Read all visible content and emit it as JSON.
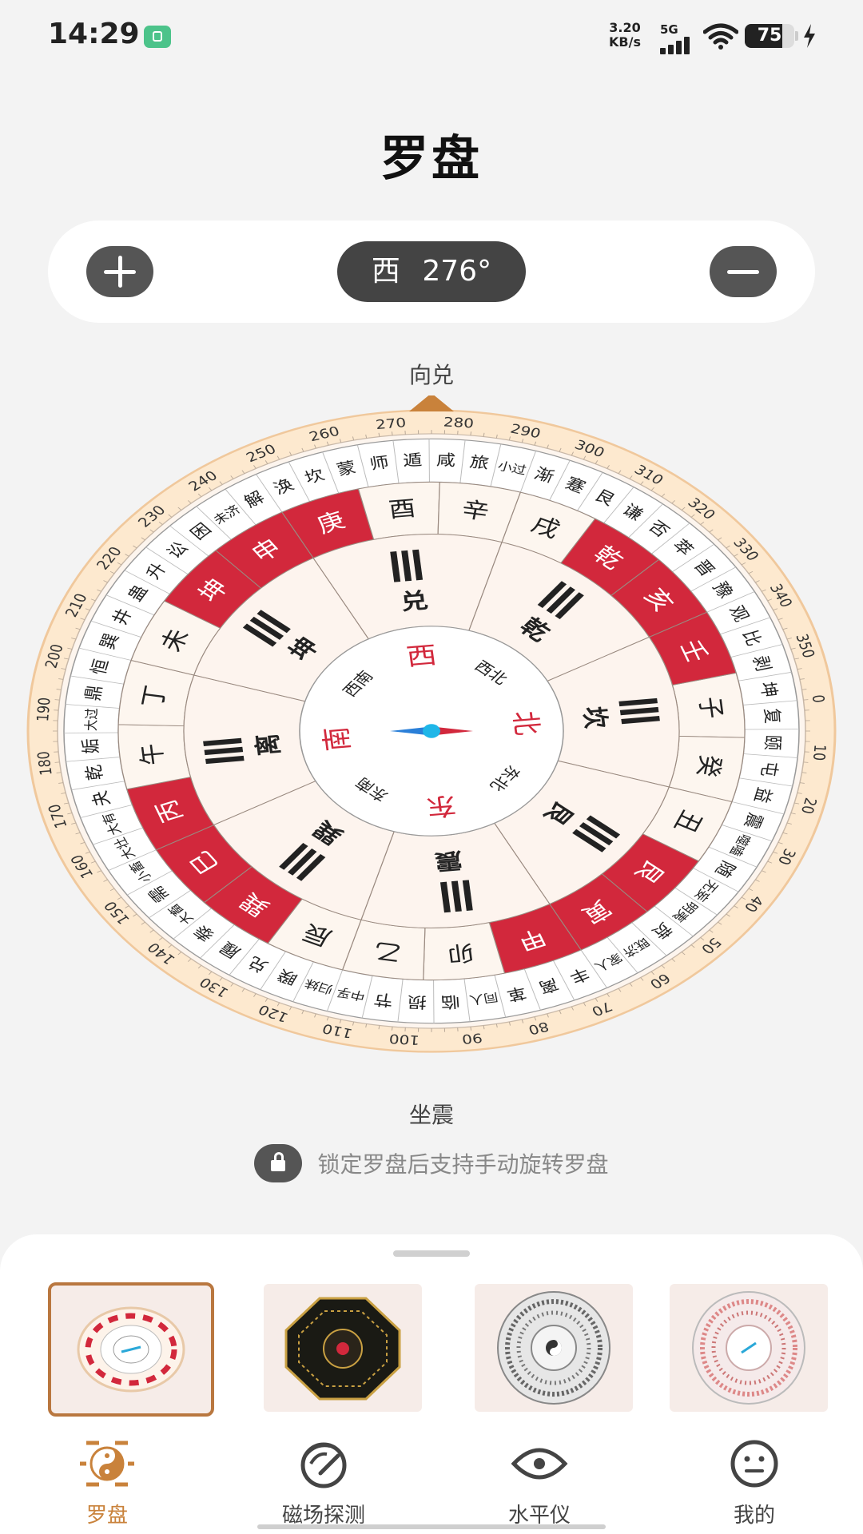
{
  "status_bar": {
    "time": "14:29",
    "net_speed_value": "3.20",
    "net_speed_unit": "KB/s",
    "network_type": "5G",
    "battery_level": "75",
    "icons": [
      "app-notification-icon",
      "signal-bars-icon",
      "wifi-icon",
      "battery-icon",
      "charging-icon"
    ]
  },
  "header": {
    "title": "罗盘"
  },
  "controls": {
    "zoom_in_icon": "plus-icon",
    "zoom_out_icon": "minus-icon",
    "direction": "西",
    "degrees": "276°"
  },
  "compass": {
    "facing": "向兑",
    "sitting": "坐震",
    "rotation_degrees": 276,
    "inner_directions": [
      {
        "label": "南",
        "angle": 180,
        "red": true
      },
      {
        "label": "西南",
        "angle": 225,
        "red": false
      },
      {
        "label": "西",
        "angle": 270,
        "red": true
      },
      {
        "label": "西北",
        "angle": 315,
        "red": false
      },
      {
        "label": "北",
        "angle": 0,
        "red": true
      },
      {
        "label": "东北",
        "angle": 45,
        "red": false
      },
      {
        "label": "东",
        "angle": 90,
        "red": true
      },
      {
        "label": "东南",
        "angle": 135,
        "red": false
      }
    ],
    "trigrams": [
      {
        "name": "离",
        "angle": 180
      },
      {
        "name": "坤",
        "angle": 225
      },
      {
        "name": "兑",
        "angle": 270
      },
      {
        "name": "乾",
        "angle": 315
      },
      {
        "name": "坎",
        "angle": 0
      },
      {
        "name": "艮",
        "angle": 45
      },
      {
        "name": "震",
        "angle": 90
      },
      {
        "name": "巽",
        "angle": 135
      }
    ],
    "mountains": [
      {
        "name": "子",
        "red": false
      },
      {
        "name": "癸",
        "red": false
      },
      {
        "name": "丑",
        "red": false
      },
      {
        "name": "艮",
        "red": true
      },
      {
        "name": "寅",
        "red": true
      },
      {
        "name": "甲",
        "red": true
      },
      {
        "name": "卯",
        "red": false
      },
      {
        "name": "乙",
        "red": false
      },
      {
        "name": "辰",
        "red": false
      },
      {
        "name": "巽",
        "red": true
      },
      {
        "name": "巳",
        "red": true
      },
      {
        "name": "丙",
        "red": true
      },
      {
        "name": "午",
        "red": false
      },
      {
        "name": "丁",
        "red": false
      },
      {
        "name": "未",
        "red": false
      },
      {
        "name": "坤",
        "red": true
      },
      {
        "name": "申",
        "red": true
      },
      {
        "name": "庚",
        "red": true
      },
      {
        "name": "酉",
        "red": false
      },
      {
        "name": "辛",
        "red": false
      },
      {
        "name": "戌",
        "red": false
      },
      {
        "name": "乾",
        "red": true
      },
      {
        "name": "亥",
        "red": true
      },
      {
        "name": "壬",
        "red": true
      }
    ],
    "hexagram_ring": [
      "复",
      "颐",
      "屯",
      "益",
      "震",
      "噬嗑",
      "随",
      "无妄",
      "明夷",
      "贲",
      "既济",
      "家人",
      "丰",
      "离",
      "革",
      "同人",
      "临",
      "损",
      "节",
      "中孚",
      "归妹",
      "睽",
      "兑",
      "履",
      "泰",
      "大畜",
      "需",
      "小畜",
      "大壮",
      "大有",
      "夬",
      "乾",
      "姤",
      "大过",
      "鼎",
      "恒",
      "巽",
      "井",
      "蛊",
      "升",
      "讼",
      "困",
      "未济",
      "解",
      "涣",
      "坎",
      "蒙",
      "师",
      "遁",
      "咸",
      "旅",
      "小过",
      "渐",
      "蹇",
      "艮",
      "谦",
      "否",
      "萃",
      "晋",
      "豫",
      "观",
      "比",
      "剥",
      "坤"
    ],
    "degree_ring": [
      "0",
      "10",
      "20",
      "30",
      "40",
      "50",
      "60",
      "70",
      "80",
      "90",
      "100",
      "110",
      "120",
      "130",
      "140",
      "150",
      "160",
      "170",
      "180",
      "190",
      "200",
      "210",
      "220",
      "230",
      "240",
      "250",
      "260",
      "270",
      "280",
      "290",
      "300",
      "310",
      "320",
      "330",
      "340",
      "350"
    ]
  },
  "lock_hint": {
    "text": "锁定罗盘后支持手动旋转罗盘",
    "icon": "unlock-icon"
  },
  "styles": [
    {
      "id": "classic-compass",
      "selected": true
    },
    {
      "id": "bagua-gold-compass",
      "selected": false
    },
    {
      "id": "gray-compass",
      "selected": false
    },
    {
      "id": "pink-compass",
      "selected": false
    }
  ],
  "nav": [
    {
      "label": "罗盘",
      "icon": "yin-yang-icon",
      "active": true
    },
    {
      "label": "磁场探测",
      "icon": "magnetic-field-icon",
      "active": false
    },
    {
      "label": "水平仪",
      "icon": "level-icon",
      "active": false
    },
    {
      "label": "我的",
      "icon": "profile-icon",
      "active": false
    }
  ],
  "colors": {
    "accent": "#c9823b",
    "red": "#d2283c",
    "dark": "#444444"
  }
}
